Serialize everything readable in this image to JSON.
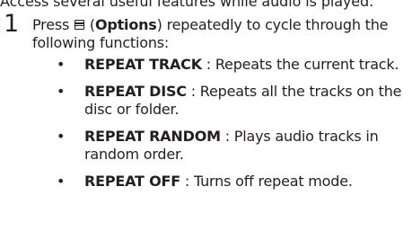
{
  "intro": "Access several useful features while audio is played.",
  "step": {
    "number": "1",
    "text_before": "Press ",
    "icon": "options-icon",
    "open_paren": " (",
    "button_name": "Options",
    "text_after": ") repeatedly to cycle through the following functions:"
  },
  "functions": [
    {
      "term": "REPEAT TRACK",
      "description": " : Repeats the current track."
    },
    {
      "term": "REPEAT DISC",
      "description": " : Repeats all the tracks on the disc or folder."
    },
    {
      "term": "REPEAT RANDOM",
      "description": " : Plays audio tracks in random order."
    },
    {
      "term": "REPEAT OFF",
      "description": " : Turns off repeat mode."
    }
  ],
  "bullet_char": "•"
}
